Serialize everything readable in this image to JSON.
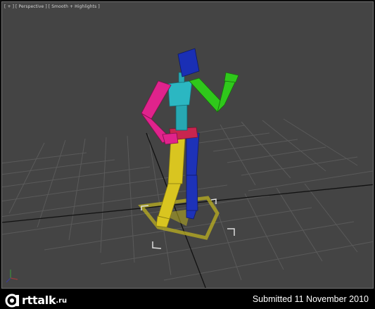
{
  "viewport": {
    "label": "[ + ] [ Perspective ] [ Smooth + Highlights ]"
  },
  "footer": {
    "logo_text": "rttalk",
    "logo_suffix": ".ru",
    "submitted": "Submitted 11 November 2010"
  },
  "colors": {
    "viewport_bg": "#444444",
    "grid": "#5c5c5c",
    "head": "#1a2fb5",
    "torso": "#2bb7c2",
    "right_arm": "#e0238c",
    "left_arm": "#2fc81b",
    "left_leg": "#d9c520",
    "right_leg": "#1d32b8",
    "hips": "#c8254f",
    "footprint": "#bcb020"
  }
}
